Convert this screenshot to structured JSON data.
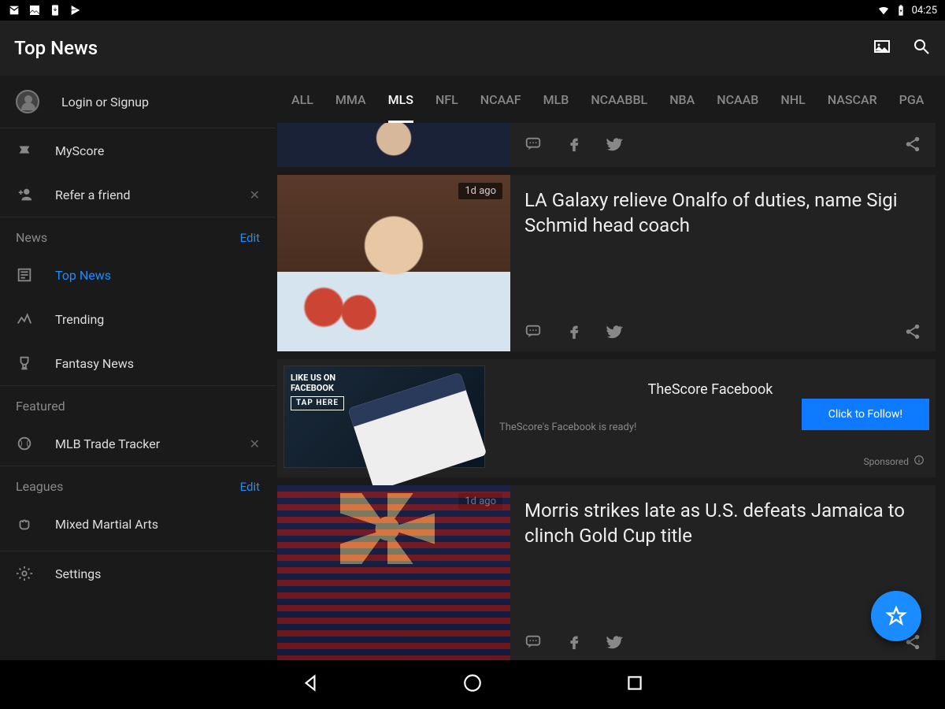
{
  "status": {
    "time": "04:25"
  },
  "appbar": {
    "title": "Top News"
  },
  "sidebar": {
    "login": "Login or Signup",
    "myscore": "MyScore",
    "refer": "Refer a friend",
    "news_header": "News",
    "edit": "Edit",
    "topnews": "Top News",
    "trending": "Trending",
    "fantasy": "Fantasy News",
    "featured_header": "Featured",
    "mlbtracker": "MLB Trade Tracker",
    "leagues_header": "Leagues",
    "mma": "Mixed Martial Arts",
    "settings": "Settings"
  },
  "tabs": [
    "ALL",
    "MMA",
    "MLS",
    "NFL",
    "NCAAF",
    "MLB",
    "NCAABBL",
    "NBA",
    "NCAAB",
    "NHL",
    "NASCAR",
    "PGA"
  ],
  "active_tab": "MLS",
  "cards": {
    "c1_time": "1d ago",
    "c1_title": "LA Galaxy relieve Onalfo of duties, name Sigi Schmid head coach",
    "c2_time": "1d ago",
    "c2_title": "Morris strikes late as U.S. defeats Jamaica to clinch Gold Cup title"
  },
  "promo": {
    "title": "TheScore Facebook",
    "subtitle": "TheScore's Facebook is ready!",
    "btn": "Click to Follow!",
    "sponsored": "Sponsored",
    "banner1": "LIKE US ON",
    "banner2": "FACEBOOK",
    "tap": "TAP HERE"
  }
}
